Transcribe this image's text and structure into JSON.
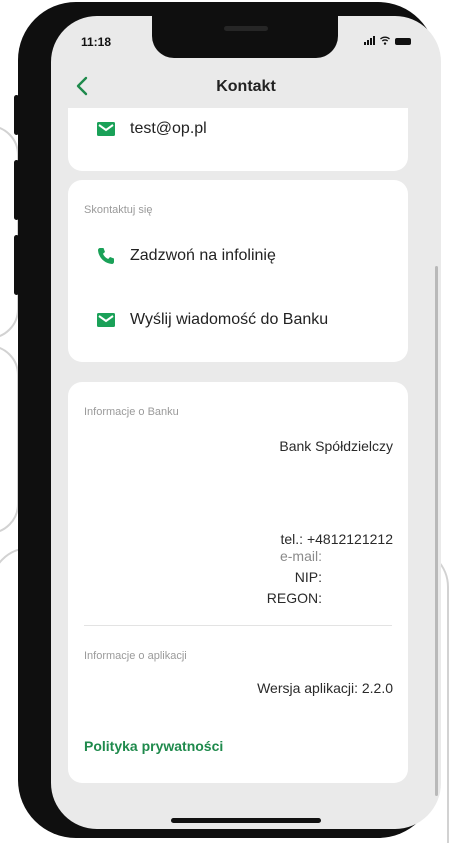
{
  "status_bar": {
    "time": "11:18",
    "icons": [
      "signal-icon",
      "wifi-icon",
      "battery-icon"
    ]
  },
  "header": {
    "title": "Kontakt",
    "back_icon": "chevron-left-icon"
  },
  "email_card": {
    "email": "test@op.pl",
    "icon": "mail-icon"
  },
  "contact_card": {
    "label": "Skontaktuj się",
    "items": [
      {
        "label": "Zadzwoń na infolinię",
        "icon": "phone-icon"
      },
      {
        "label": "Wyślij wiadomość do Banku",
        "icon": "mail-icon"
      }
    ]
  },
  "bank_info": {
    "label": "Informacje o Banku",
    "bank_name": "Bank Spółdzielczy",
    "phone": "tel.: +4812121212",
    "email": "e-mail:",
    "nip": "NIP:",
    "regon": "REGON:"
  },
  "app_info": {
    "label": "Informacje o aplikacji",
    "version": "Wersja aplikacji: 2.2.0",
    "privacy_link": "Polityka prywatności"
  },
  "colors": {
    "accent": "#1f8a4c",
    "icon_green": "#1aa158",
    "background": "#eaeaea",
    "card": "#ffffff"
  }
}
